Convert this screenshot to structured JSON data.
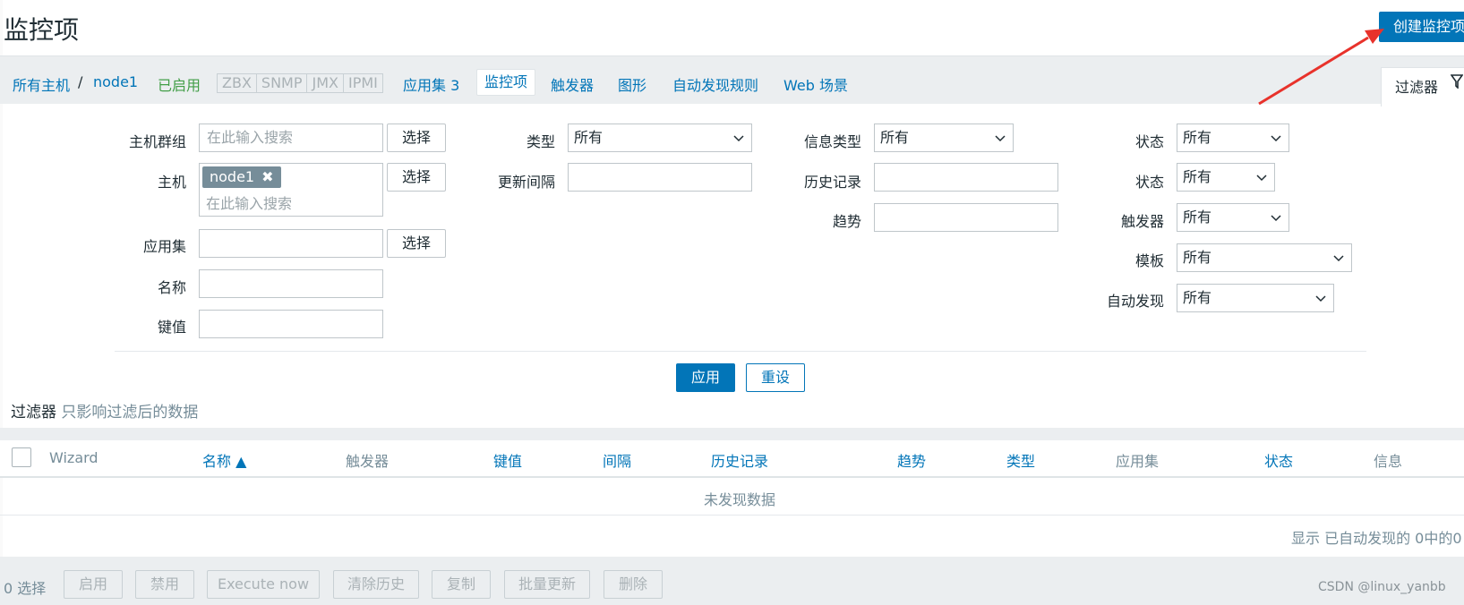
{
  "page": {
    "title": "监控项",
    "create_button": "创建监控项"
  },
  "nav": {
    "all_hosts": "所有主机",
    "separator": "/",
    "host": "node1",
    "status": "已启用",
    "protocols": [
      "ZBX",
      "SNMP",
      "JMX",
      "IPMI"
    ],
    "applications": "应用集 3",
    "items": "监控项",
    "triggers": "触发器",
    "graphs": "图形",
    "discovery": "自动发现规则",
    "web": "Web 场景",
    "filter_tab": "过滤器"
  },
  "filter": {
    "host_groups_label": "主机群组",
    "host_groups_placeholder": "在此输入搜索",
    "hosts_label": "主机",
    "host_tag": "node1",
    "host_tag_remove": "✖",
    "hosts_placeholder": "在此输入搜索",
    "applications_label": "应用集",
    "name_label": "名称",
    "key_label": "键值",
    "select_button": "选择",
    "type_label": "类型",
    "type_value": "所有",
    "update_interval_label": "更新间隔",
    "info_type_label": "信息类型",
    "info_type_value": "所有",
    "history_label": "历史记录",
    "trends_label": "趋势",
    "state_label": "状态",
    "state_value": "所有",
    "status_label": "状态",
    "status_value": "所有",
    "triggers_label": "触发器",
    "triggers_value": "所有",
    "template_label": "模板",
    "template_value": "所有",
    "discovered_label": "自动发现",
    "discovered_value": "所有",
    "apply_button": "应用",
    "reset_button": "重设",
    "note_prefix": "过滤器",
    "note_text": "只影响过滤后的数据"
  },
  "table": {
    "columns": [
      "Wizard",
      "名称 ▲",
      "触发器",
      "键值",
      "间隔",
      "历史记录",
      "趋势",
      "类型",
      "应用集",
      "状态",
      "信息"
    ],
    "empty_text": "未发现数据",
    "paging_text": "显示 已自动发现的 0中的0"
  },
  "footer": {
    "selected": "0 选择",
    "buttons": [
      "启用",
      "禁用",
      "Execute now",
      "清除历史",
      "复制",
      "批量更新",
      "删除"
    ],
    "watermark": "CSDN @linux_yanbb"
  },
  "colors": {
    "accent": "#0275b8",
    "enabled_green": "#429e47",
    "annotation_arrow": "#e8322b"
  }
}
